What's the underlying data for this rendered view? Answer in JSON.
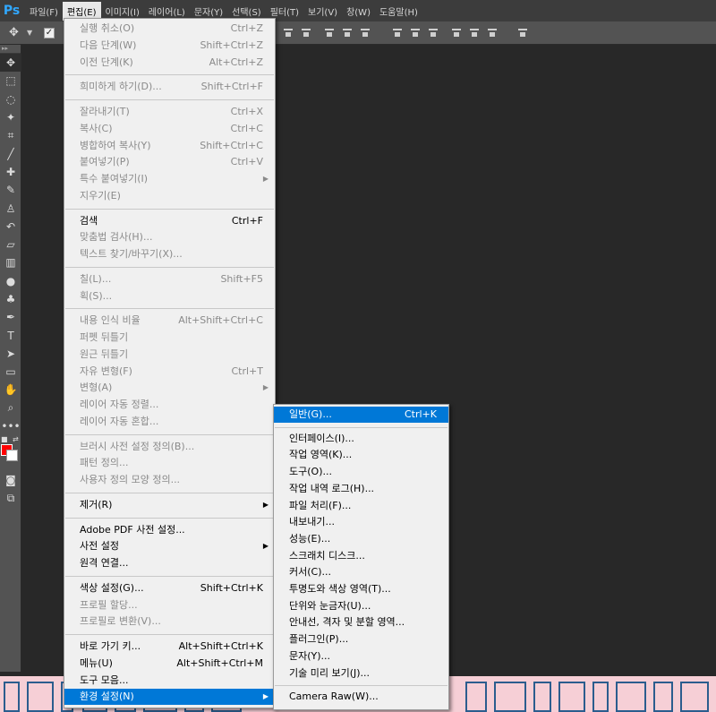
{
  "app": {
    "logo": "Ps"
  },
  "menubar": {
    "items": [
      "파일(F)",
      "편집(E)",
      "이미지(I)",
      "레이어(L)",
      "문자(Y)",
      "선택(S)",
      "필터(T)",
      "보기(V)",
      "창(W)",
      "도움말(H)"
    ]
  },
  "edit_menu": {
    "items": [
      {
        "label": "실행 취소(O)",
        "shortcut": "Ctrl+Z",
        "disabled": true
      },
      {
        "label": "다음 단계(W)",
        "shortcut": "Shift+Ctrl+Z",
        "disabled": true
      },
      {
        "label": "이전 단계(K)",
        "shortcut": "Alt+Ctrl+Z",
        "disabled": true
      },
      {
        "sep": true
      },
      {
        "label": "희미하게 하기(D)...",
        "shortcut": "Shift+Ctrl+F",
        "disabled": true
      },
      {
        "sep": true
      },
      {
        "label": "잘라내기(T)",
        "shortcut": "Ctrl+X",
        "disabled": true
      },
      {
        "label": "복사(C)",
        "shortcut": "Ctrl+C",
        "disabled": true
      },
      {
        "label": "병합하여 복사(Y)",
        "shortcut": "Shift+Ctrl+C",
        "disabled": true
      },
      {
        "label": "붙여넣기(P)",
        "shortcut": "Ctrl+V",
        "disabled": true
      },
      {
        "label": "특수 붙여넣기(I)",
        "shortcut": "",
        "disabled": true,
        "submenu": true
      },
      {
        "label": "지우기(E)",
        "shortcut": "",
        "disabled": true
      },
      {
        "sep": true
      },
      {
        "label": "검색",
        "shortcut": "Ctrl+F",
        "disabled": false
      },
      {
        "label": "맞춤법 검사(H)...",
        "shortcut": "",
        "disabled": true
      },
      {
        "label": "텍스트 찾기/바꾸기(X)...",
        "shortcut": "",
        "disabled": true
      },
      {
        "sep": true
      },
      {
        "label": "칠(L)...",
        "shortcut": "Shift+F5",
        "disabled": true
      },
      {
        "label": "획(S)...",
        "shortcut": "",
        "disabled": true
      },
      {
        "sep": true
      },
      {
        "label": "내용 인식 비율",
        "shortcut": "Alt+Shift+Ctrl+C",
        "disabled": true
      },
      {
        "label": "퍼펫 뒤틀기",
        "shortcut": "",
        "disabled": true
      },
      {
        "label": "원근 뒤틀기",
        "shortcut": "",
        "disabled": true
      },
      {
        "label": "자유 변형(F)",
        "shortcut": "Ctrl+T",
        "disabled": true
      },
      {
        "label": "변형(A)",
        "shortcut": "",
        "disabled": true,
        "submenu": true
      },
      {
        "label": "레이어 자동 정렬...",
        "shortcut": "",
        "disabled": true
      },
      {
        "label": "레이어 자동 혼합...",
        "shortcut": "",
        "disabled": true
      },
      {
        "sep": true
      },
      {
        "label": "브러시 사전 설정 정의(B)...",
        "shortcut": "",
        "disabled": true
      },
      {
        "label": "패턴 정의...",
        "shortcut": "",
        "disabled": true
      },
      {
        "label": "사용자 정의 모양 정의...",
        "shortcut": "",
        "disabled": true
      },
      {
        "sep": true
      },
      {
        "label": "제거(R)",
        "shortcut": "",
        "disabled": false,
        "submenu": true
      },
      {
        "sep": true
      },
      {
        "label": "Adobe PDF 사전 설정...",
        "shortcut": "",
        "disabled": false
      },
      {
        "label": "사전 설정",
        "shortcut": "",
        "disabled": false,
        "submenu": true
      },
      {
        "label": "원격 연결...",
        "shortcut": "",
        "disabled": false
      },
      {
        "sep": true
      },
      {
        "label": "색상 설정(G)...",
        "shortcut": "Shift+Ctrl+K",
        "disabled": false
      },
      {
        "label": "프로필 할당...",
        "shortcut": "",
        "disabled": true
      },
      {
        "label": "프로필로 변환(V)...",
        "shortcut": "",
        "disabled": true
      },
      {
        "sep": true
      },
      {
        "label": "바로 가기 키...",
        "shortcut": "Alt+Shift+Ctrl+K",
        "disabled": false
      },
      {
        "label": "메뉴(U)",
        "shortcut": "Alt+Shift+Ctrl+M",
        "disabled": false
      },
      {
        "label": "도구 모음...",
        "shortcut": "",
        "disabled": false
      },
      {
        "label": "환경 설정(N)",
        "shortcut": "",
        "disabled": false,
        "submenu": true,
        "highlight": true
      }
    ]
  },
  "pref_menu": {
    "items": [
      {
        "label": "일반(G)...",
        "shortcut": "Ctrl+K",
        "highlight": true
      },
      {
        "sep": true
      },
      {
        "label": "인터페이스(I)...",
        "shortcut": ""
      },
      {
        "label": "작업 영역(K)...",
        "shortcut": ""
      },
      {
        "label": "도구(O)...",
        "shortcut": ""
      },
      {
        "label": "작업 내역 로그(H)...",
        "shortcut": ""
      },
      {
        "label": "파일 처리(F)...",
        "shortcut": ""
      },
      {
        "label": "내보내기...",
        "shortcut": ""
      },
      {
        "label": "성능(E)...",
        "shortcut": ""
      },
      {
        "label": "스크래치 디스크...",
        "shortcut": ""
      },
      {
        "label": "커서(C)...",
        "shortcut": ""
      },
      {
        "label": "투명도와 색상 영역(T)...",
        "shortcut": ""
      },
      {
        "label": "단위와 눈금자(U)...",
        "shortcut": ""
      },
      {
        "label": "안내선, 격자 및 분할 영역...",
        "shortcut": ""
      },
      {
        "label": "플러그인(P)...",
        "shortcut": ""
      },
      {
        "label": "문자(Y)...",
        "shortcut": ""
      },
      {
        "label": "기술 미리 보기(J)...",
        "shortcut": ""
      },
      {
        "sep": true
      },
      {
        "label": "Camera Raw(W)...",
        "shortcut": ""
      }
    ]
  },
  "tools": [
    "move-icon",
    "marquee-icon",
    "lasso-icon",
    "magic-wand-icon",
    "crop-icon",
    "eyedropper-icon",
    "healing-brush-icon",
    "brush-icon",
    "clone-stamp-icon",
    "history-brush-icon",
    "eraser-icon",
    "gradient-icon",
    "blur-icon",
    "dodge-icon",
    "pen-icon",
    "type-icon",
    "path-selection-icon",
    "rectangle-icon",
    "hand-icon",
    "zoom-icon",
    "more-tools-icon"
  ],
  "colors": {
    "foreground": "#ff0000",
    "background": "#ffffff",
    "highlight": "#0078d7"
  }
}
